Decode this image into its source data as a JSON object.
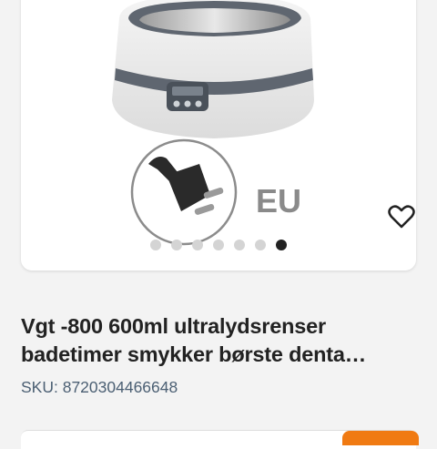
{
  "product": {
    "image_icon": "ultrasonic-cleaner-image",
    "plug_label": "EU",
    "title_line1": "Vgt -800 600ml ultralydsrenser",
    "title_line2": "badetimer smykker børste denta…",
    "sku": "SKU: 8720304466648"
  },
  "carousel": {
    "count": 7,
    "active_index": 6
  },
  "favorite": {
    "icon": "heart-icon"
  },
  "colors": {
    "accent": "#f07a12",
    "dot_inactive": "#d4d4d4",
    "dot_active": "#222222",
    "sku_text": "#4b5f73"
  }
}
